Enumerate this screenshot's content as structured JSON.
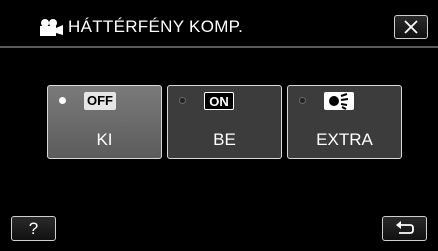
{
  "header": {
    "icon": "movie-camera-icon",
    "title": "HÁTTÉRFÉNY KOMP."
  },
  "close": {
    "icon": "close-icon"
  },
  "options": [
    {
      "icon_text": "OFF",
      "label": "KI",
      "selected": true
    },
    {
      "icon_text": "ON",
      "label": "BE",
      "selected": false
    },
    {
      "icon": "extra-backlight-icon",
      "label": "EXTRA",
      "selected": false
    }
  ],
  "footer": {
    "help_label": "?",
    "back_icon": "return-icon"
  }
}
